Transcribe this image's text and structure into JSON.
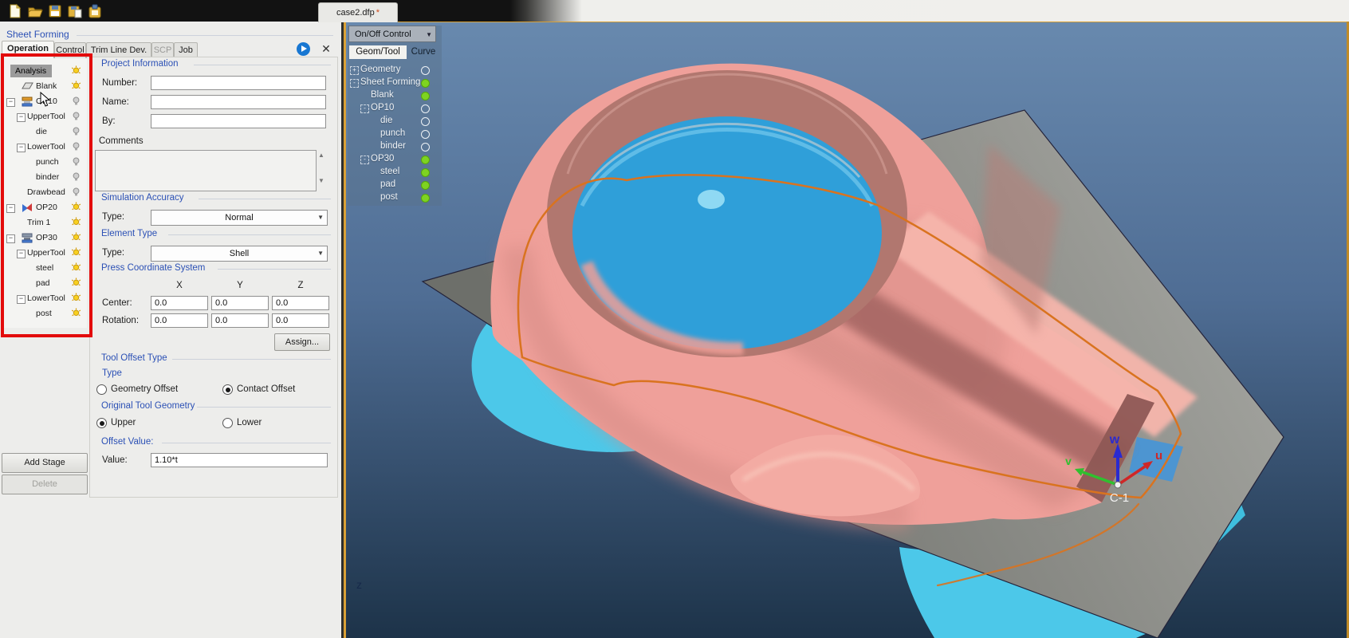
{
  "window": {
    "doc_tab": "case2.dfp",
    "doc_modified_marker": "*",
    "toolbar_icons": [
      "new-file",
      "open-file",
      "save-file",
      "save-as-file",
      "import-project"
    ]
  },
  "sheet_forming_panel": {
    "title": "Sheet Forming",
    "tabs": [
      {
        "label": "Operation",
        "state": "active"
      },
      {
        "label": "Control",
        "state": "normal"
      },
      {
        "label": "Trim Line Dev.",
        "state": "normal"
      },
      {
        "label": "SCP",
        "state": "disabled"
      },
      {
        "label": "Job",
        "state": "normal"
      }
    ],
    "tree": {
      "items": [
        {
          "label": "Analysis",
          "level": 0,
          "exp": null,
          "icon": null,
          "bulb": "on",
          "selected": true
        },
        {
          "label": "Blank",
          "level": 2,
          "exp": null,
          "icon": "blank",
          "bulb": "on",
          "selected": false
        },
        {
          "label": "OP10",
          "level": 2,
          "exp": "root",
          "icon": "op10",
          "bulb": "off",
          "selected": false
        },
        {
          "label": "UpperTool",
          "level": 1,
          "exp": "mid",
          "icon": null,
          "bulb": "off",
          "selected": false
        },
        {
          "label": "die",
          "level": 2,
          "exp": null,
          "icon": null,
          "bulb": "off",
          "selected": false
        },
        {
          "label": "LowerTool",
          "level": 1,
          "exp": "mid",
          "icon": null,
          "bulb": "off",
          "selected": false
        },
        {
          "label": "punch",
          "level": 2,
          "exp": null,
          "icon": null,
          "bulb": "off",
          "selected": false
        },
        {
          "label": "binder",
          "level": 2,
          "exp": null,
          "icon": null,
          "bulb": "off",
          "selected": false
        },
        {
          "label": "Drawbead",
          "level": 1,
          "exp": null,
          "icon": null,
          "bulb": "off",
          "selected": false
        },
        {
          "label": "OP20",
          "level": 2,
          "exp": "root",
          "icon": "op20",
          "bulb": "on",
          "selected": false
        },
        {
          "label": "Trim 1",
          "level": 1,
          "exp": null,
          "icon": null,
          "bulb": "on",
          "selected": false
        },
        {
          "label": "OP30",
          "level": 2,
          "exp": "root",
          "icon": "op30",
          "bulb": "on",
          "selected": false
        },
        {
          "label": "UpperTool",
          "level": 1,
          "exp": "mid",
          "icon": null,
          "bulb": "on",
          "selected": false
        },
        {
          "label": "steel",
          "level": 2,
          "exp": null,
          "icon": null,
          "bulb": "on",
          "selected": false
        },
        {
          "label": "pad",
          "level": 2,
          "exp": null,
          "icon": null,
          "bulb": "on",
          "selected": false
        },
        {
          "label": "LowerTool",
          "level": 1,
          "exp": "mid",
          "icon": null,
          "bulb": "on",
          "selected": false
        },
        {
          "label": "post",
          "level": 2,
          "exp": null,
          "icon": null,
          "bulb": "on",
          "selected": false
        }
      ]
    },
    "project_information": {
      "title": "Project Information",
      "fields": [
        {
          "label": "Number:",
          "value": ""
        },
        {
          "label": "Name:",
          "value": ""
        },
        {
          "label": "By:",
          "value": ""
        }
      ],
      "comments_label": "Comments",
      "comments_value": ""
    },
    "simulation_accuracy": {
      "title": "Simulation Accuracy",
      "type_label": "Type:",
      "value": "Normal"
    },
    "element_type": {
      "title": "Element Type",
      "type_label": "Type:",
      "value": "Shell"
    },
    "press_coordinate_system": {
      "title": "Press Coordinate System",
      "columns": [
        "X",
        "Y",
        "Z"
      ],
      "rows": [
        {
          "label": "Center:",
          "values": [
            "0.0",
            "0.0",
            "0.0"
          ]
        },
        {
          "label": "Rotation:",
          "values": [
            "0.0",
            "0.0",
            "0.0"
          ]
        }
      ],
      "assign_label": "Assign..."
    },
    "tool_offset_type": {
      "title": "Tool Offset Type",
      "sub_label": "Type",
      "options": [
        {
          "label": "Geometry Offset",
          "selected": false
        },
        {
          "label": "Contact Offset",
          "selected": true
        }
      ]
    },
    "original_tool_geometry": {
      "title": "Original Tool Geometry",
      "options": [
        {
          "label": "Upper",
          "selected": true
        },
        {
          "label": "Lower",
          "selected": false
        }
      ]
    },
    "offset_value": {
      "title": "Offset Value:",
      "label": "Value:",
      "value": "1.10*t"
    },
    "buttons": {
      "add_stage": "Add Stage",
      "delete": "Delete"
    }
  },
  "onoff_panel": {
    "dropdown_value": "On/Off Control",
    "tabs": [
      {
        "label": "Geom/Tool",
        "state": "active"
      },
      {
        "label": "Curve",
        "state": "normal"
      }
    ],
    "items": [
      {
        "label": "Geometry",
        "level": 0,
        "exp": "+",
        "state": "off"
      },
      {
        "label": "Sheet Forming",
        "level": 0,
        "exp": "-",
        "state": "on"
      },
      {
        "label": "Blank",
        "level": 1,
        "exp": null,
        "state": "on"
      },
      {
        "label": "OP10",
        "level": 1,
        "exp": "-",
        "state": "off"
      },
      {
        "label": "die",
        "level": 2,
        "exp": null,
        "state": "off"
      },
      {
        "label": "punch",
        "level": 2,
        "exp": null,
        "state": "off"
      },
      {
        "label": "binder",
        "level": 2,
        "exp": null,
        "state": "off"
      },
      {
        "label": "OP30",
        "level": 1,
        "exp": "-",
        "state": "on"
      },
      {
        "label": "steel",
        "level": 2,
        "exp": null,
        "state": "on"
      },
      {
        "label": "pad",
        "level": 2,
        "exp": null,
        "state": "on"
      },
      {
        "label": "post",
        "level": 2,
        "exp": null,
        "state": "on"
      }
    ]
  },
  "viewport": {
    "axis_triad": {
      "w": "w",
      "u": "u",
      "v": "v",
      "origin_label": "C-1"
    },
    "bottom_axis_label": "z"
  },
  "colors": {
    "accent_border": "#d9a036",
    "red_highlight": "#e30b0b",
    "header_blue": "#2b50b5",
    "viewport_top": "#6889ae",
    "viewport_bottom": "#1d3349",
    "die_pink": "#efa09a",
    "die_highlight": "#f6b6ac",
    "die_shadow": "#a26360",
    "cup_wall": "#b1776f",
    "punch_blue": "#2f9fd9",
    "punch_dot": "#8fd9f3",
    "binder_cyan": "#4cc8e9",
    "sheet_gray": "#8d8e8a",
    "trim_orange": "#d9731f",
    "axis_w": "#2a2ad0",
    "axis_u": "#cf2727",
    "axis_v": "#2fc02f",
    "bulb_on": "#f8d020",
    "state_on": "#7ed321"
  }
}
